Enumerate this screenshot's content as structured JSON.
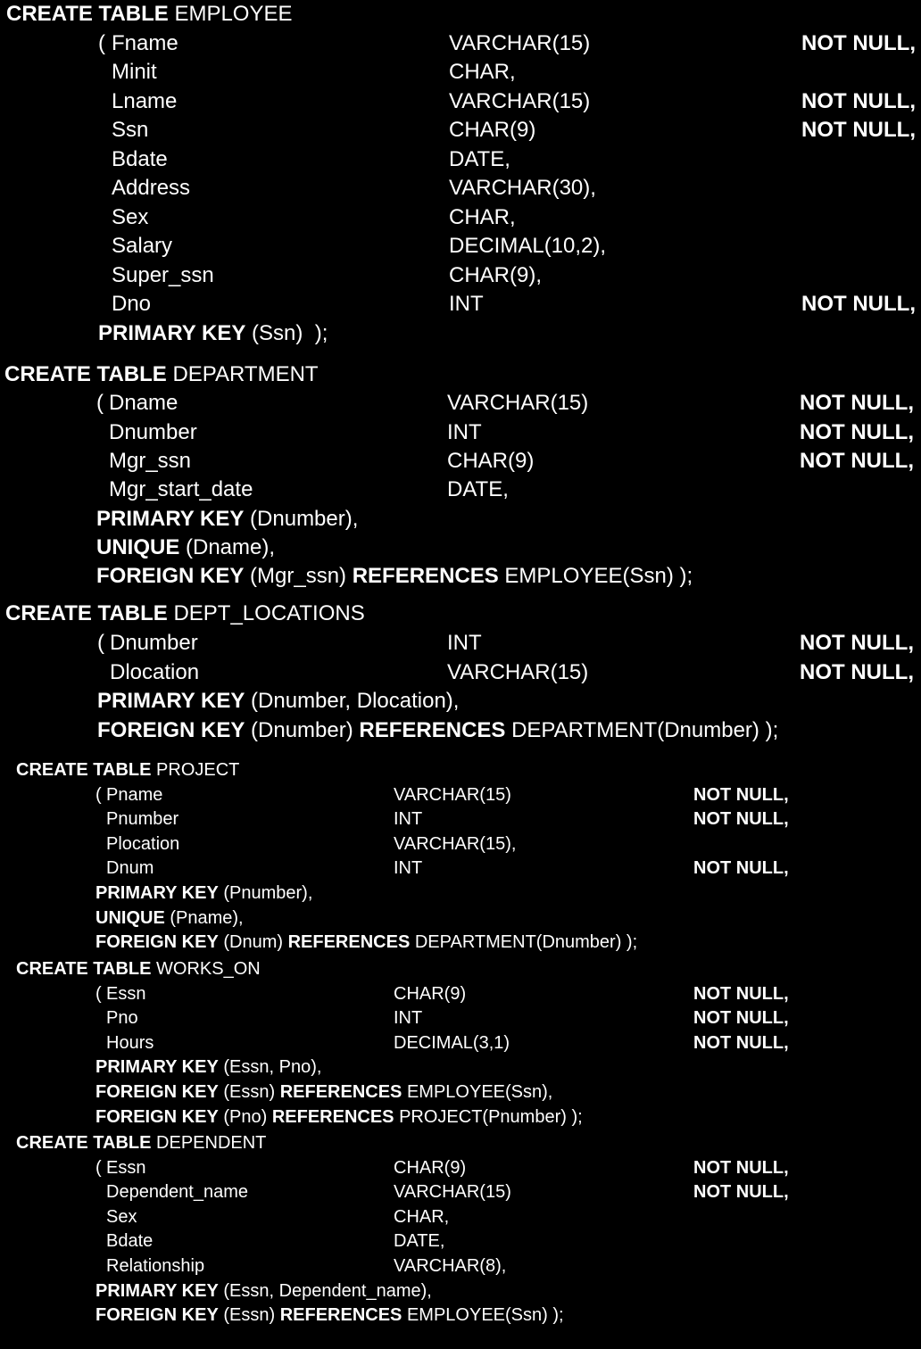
{
  "colors": {
    "background": "#000000",
    "text": "#ffffff"
  },
  "tables": [
    {
      "create_kw": "CREATE TABLE",
      "name": "EMPLOYEE",
      "columns": [
        {
          "prefix": "( ",
          "name": "Fname",
          "type": "VARCHAR(15)",
          "constraint": "NOT NULL,"
        },
        {
          "prefix": "",
          "name": "Minit",
          "type": "CHAR,",
          "constraint": ""
        },
        {
          "prefix": "",
          "name": "Lname",
          "type": "VARCHAR(15)",
          "constraint": "NOT NULL,"
        },
        {
          "prefix": "",
          "name": "Ssn",
          "type": "CHAR(9)",
          "constraint": "NOT NULL,"
        },
        {
          "prefix": "",
          "name": "Bdate",
          "type": "DATE,",
          "constraint": ""
        },
        {
          "prefix": "",
          "name": "Address",
          "type": "VARCHAR(30),",
          "constraint": ""
        },
        {
          "prefix": "",
          "name": "Sex",
          "type": "CHAR,",
          "constraint": ""
        },
        {
          "prefix": "",
          "name": "Salary",
          "type": "DECIMAL(10,2),",
          "constraint": ""
        },
        {
          "prefix": "",
          "name": "Super_ssn",
          "type": "CHAR(9),",
          "constraint": ""
        },
        {
          "prefix": "",
          "name": "Dno",
          "type": "INT",
          "constraint": "NOT NULL,"
        }
      ],
      "constraints": [
        [
          {
            "t": "PRIMARY KEY",
            "kw": true
          },
          {
            "t": " (Ssn)  );",
            "kw": false
          }
        ]
      ]
    },
    {
      "create_kw": "CREATE TABLE",
      "name": "DEPARTMENT",
      "columns": [
        {
          "prefix": "( ",
          "name": "Dname",
          "type": "VARCHAR(15)",
          "constraint": "NOT NULL,"
        },
        {
          "prefix": "",
          "name": "Dnumber",
          "type": "INT",
          "constraint": "NOT NULL,"
        },
        {
          "prefix": "",
          "name": "Mgr_ssn",
          "type": "CHAR(9)",
          "constraint": "NOT NULL,"
        },
        {
          "prefix": "",
          "name": "Mgr_start_date",
          "type": "DATE,",
          "constraint": ""
        }
      ],
      "constraints": [
        [
          {
            "t": "PRIMARY KEY",
            "kw": true
          },
          {
            "t": " (Dnumber),",
            "kw": false
          }
        ],
        [
          {
            "t": "UNIQUE",
            "kw": true
          },
          {
            "t": " (Dname),",
            "kw": false
          }
        ],
        [
          {
            "t": "FOREIGN KEY",
            "kw": true
          },
          {
            "t": " (Mgr_ssn) ",
            "kw": false
          },
          {
            "t": "REFERENCES",
            "kw": true
          },
          {
            "t": " EMPLOYEE(Ssn) );",
            "kw": false
          }
        ]
      ]
    },
    {
      "create_kw": "CREATE TABLE",
      "name": "DEPT_LOCATIONS",
      "columns": [
        {
          "prefix": "( ",
          "name": "Dnumber",
          "type": "INT",
          "constraint": "NOT NULL,"
        },
        {
          "prefix": "",
          "name": "Dlocation",
          "type": "VARCHAR(15)",
          "constraint": "NOT NULL,"
        }
      ],
      "constraints": [
        [
          {
            "t": "PRIMARY KEY",
            "kw": true
          },
          {
            "t": " (Dnumber, Dlocation),",
            "kw": false
          }
        ],
        [
          {
            "t": "FOREIGN KEY",
            "kw": true
          },
          {
            "t": " (Dnumber) ",
            "kw": false
          },
          {
            "t": "REFERENCES",
            "kw": true
          },
          {
            "t": " DEPARTMENT(Dnumber) );",
            "kw": false
          }
        ]
      ]
    },
    {
      "create_kw": "CREATE TABLE",
      "name": "PROJECT",
      "columns": [
        {
          "prefix": "( ",
          "name": "Pname",
          "type": "VARCHAR(15)",
          "constraint": "NOT NULL,"
        },
        {
          "prefix": "",
          "name": "Pnumber",
          "type": "INT",
          "constraint": "NOT NULL,"
        },
        {
          "prefix": "",
          "name": "Plocation",
          "type": "VARCHAR(15),",
          "constraint": ""
        },
        {
          "prefix": "",
          "name": "Dnum",
          "type": "INT",
          "constraint": "NOT NULL,"
        }
      ],
      "constraints": [
        [
          {
            "t": "PRIMARY KEY",
            "kw": true
          },
          {
            "t": " (Pnumber),",
            "kw": false
          }
        ],
        [
          {
            "t": "UNIQUE",
            "kw": true
          },
          {
            "t": " (Pname),",
            "kw": false
          }
        ],
        [
          {
            "t": "FOREIGN KEY",
            "kw": true
          },
          {
            "t": " (Dnum) ",
            "kw": false
          },
          {
            "t": "REFERENCES",
            "kw": true
          },
          {
            "t": " DEPARTMENT(Dnumber) );",
            "kw": false
          }
        ]
      ]
    },
    {
      "create_kw": "CREATE TABLE",
      "name": "WORKS_ON",
      "columns": [
        {
          "prefix": "( ",
          "name": "Essn",
          "type": "CHAR(9)",
          "constraint": "NOT NULL,"
        },
        {
          "prefix": "",
          "name": "Pno",
          "type": "INT",
          "constraint": "NOT NULL,"
        },
        {
          "prefix": "",
          "name": "Hours",
          "type": "DECIMAL(3,1)",
          "constraint": "NOT NULL,"
        }
      ],
      "constraints": [
        [
          {
            "t": "PRIMARY KEY",
            "kw": true
          },
          {
            "t": " (Essn, Pno),",
            "kw": false
          }
        ],
        [
          {
            "t": "FOREIGN KEY",
            "kw": true
          },
          {
            "t": " (Essn) ",
            "kw": false
          },
          {
            "t": "REFERENCES",
            "kw": true
          },
          {
            "t": " EMPLOYEE(Ssn),",
            "kw": false
          }
        ],
        [
          {
            "t": "FOREIGN KEY",
            "kw": true
          },
          {
            "t": " (Pno) ",
            "kw": false
          },
          {
            "t": "REFERENCES",
            "kw": true
          },
          {
            "t": " PROJECT(Pnumber) );",
            "kw": false
          }
        ]
      ]
    },
    {
      "create_kw": "CREATE TABLE",
      "name": "DEPENDENT",
      "columns": [
        {
          "prefix": "( ",
          "name": "Essn",
          "type": "CHAR(9)",
          "constraint": "NOT NULL,"
        },
        {
          "prefix": "",
          "name": "Dependent_name",
          "type": "VARCHAR(15)",
          "constraint": "NOT NULL,"
        },
        {
          "prefix": "",
          "name": "Sex",
          "type": "CHAR,",
          "constraint": ""
        },
        {
          "prefix": "",
          "name": "Bdate",
          "type": "DATE,",
          "constraint": ""
        },
        {
          "prefix": "",
          "name": "Relationship",
          "type": "VARCHAR(8),",
          "constraint": ""
        }
      ],
      "constraints": [
        [
          {
            "t": "PRIMARY KEY",
            "kw": true
          },
          {
            "t": " (Essn, Dependent_name),",
            "kw": false
          }
        ],
        [
          {
            "t": "FOREIGN KEY",
            "kw": true
          },
          {
            "t": " (Essn) ",
            "kw": false
          },
          {
            "t": "REFERENCES",
            "kw": true
          },
          {
            "t": " EMPLOYEE(Ssn) );",
            "kw": false
          }
        ]
      ]
    }
  ]
}
